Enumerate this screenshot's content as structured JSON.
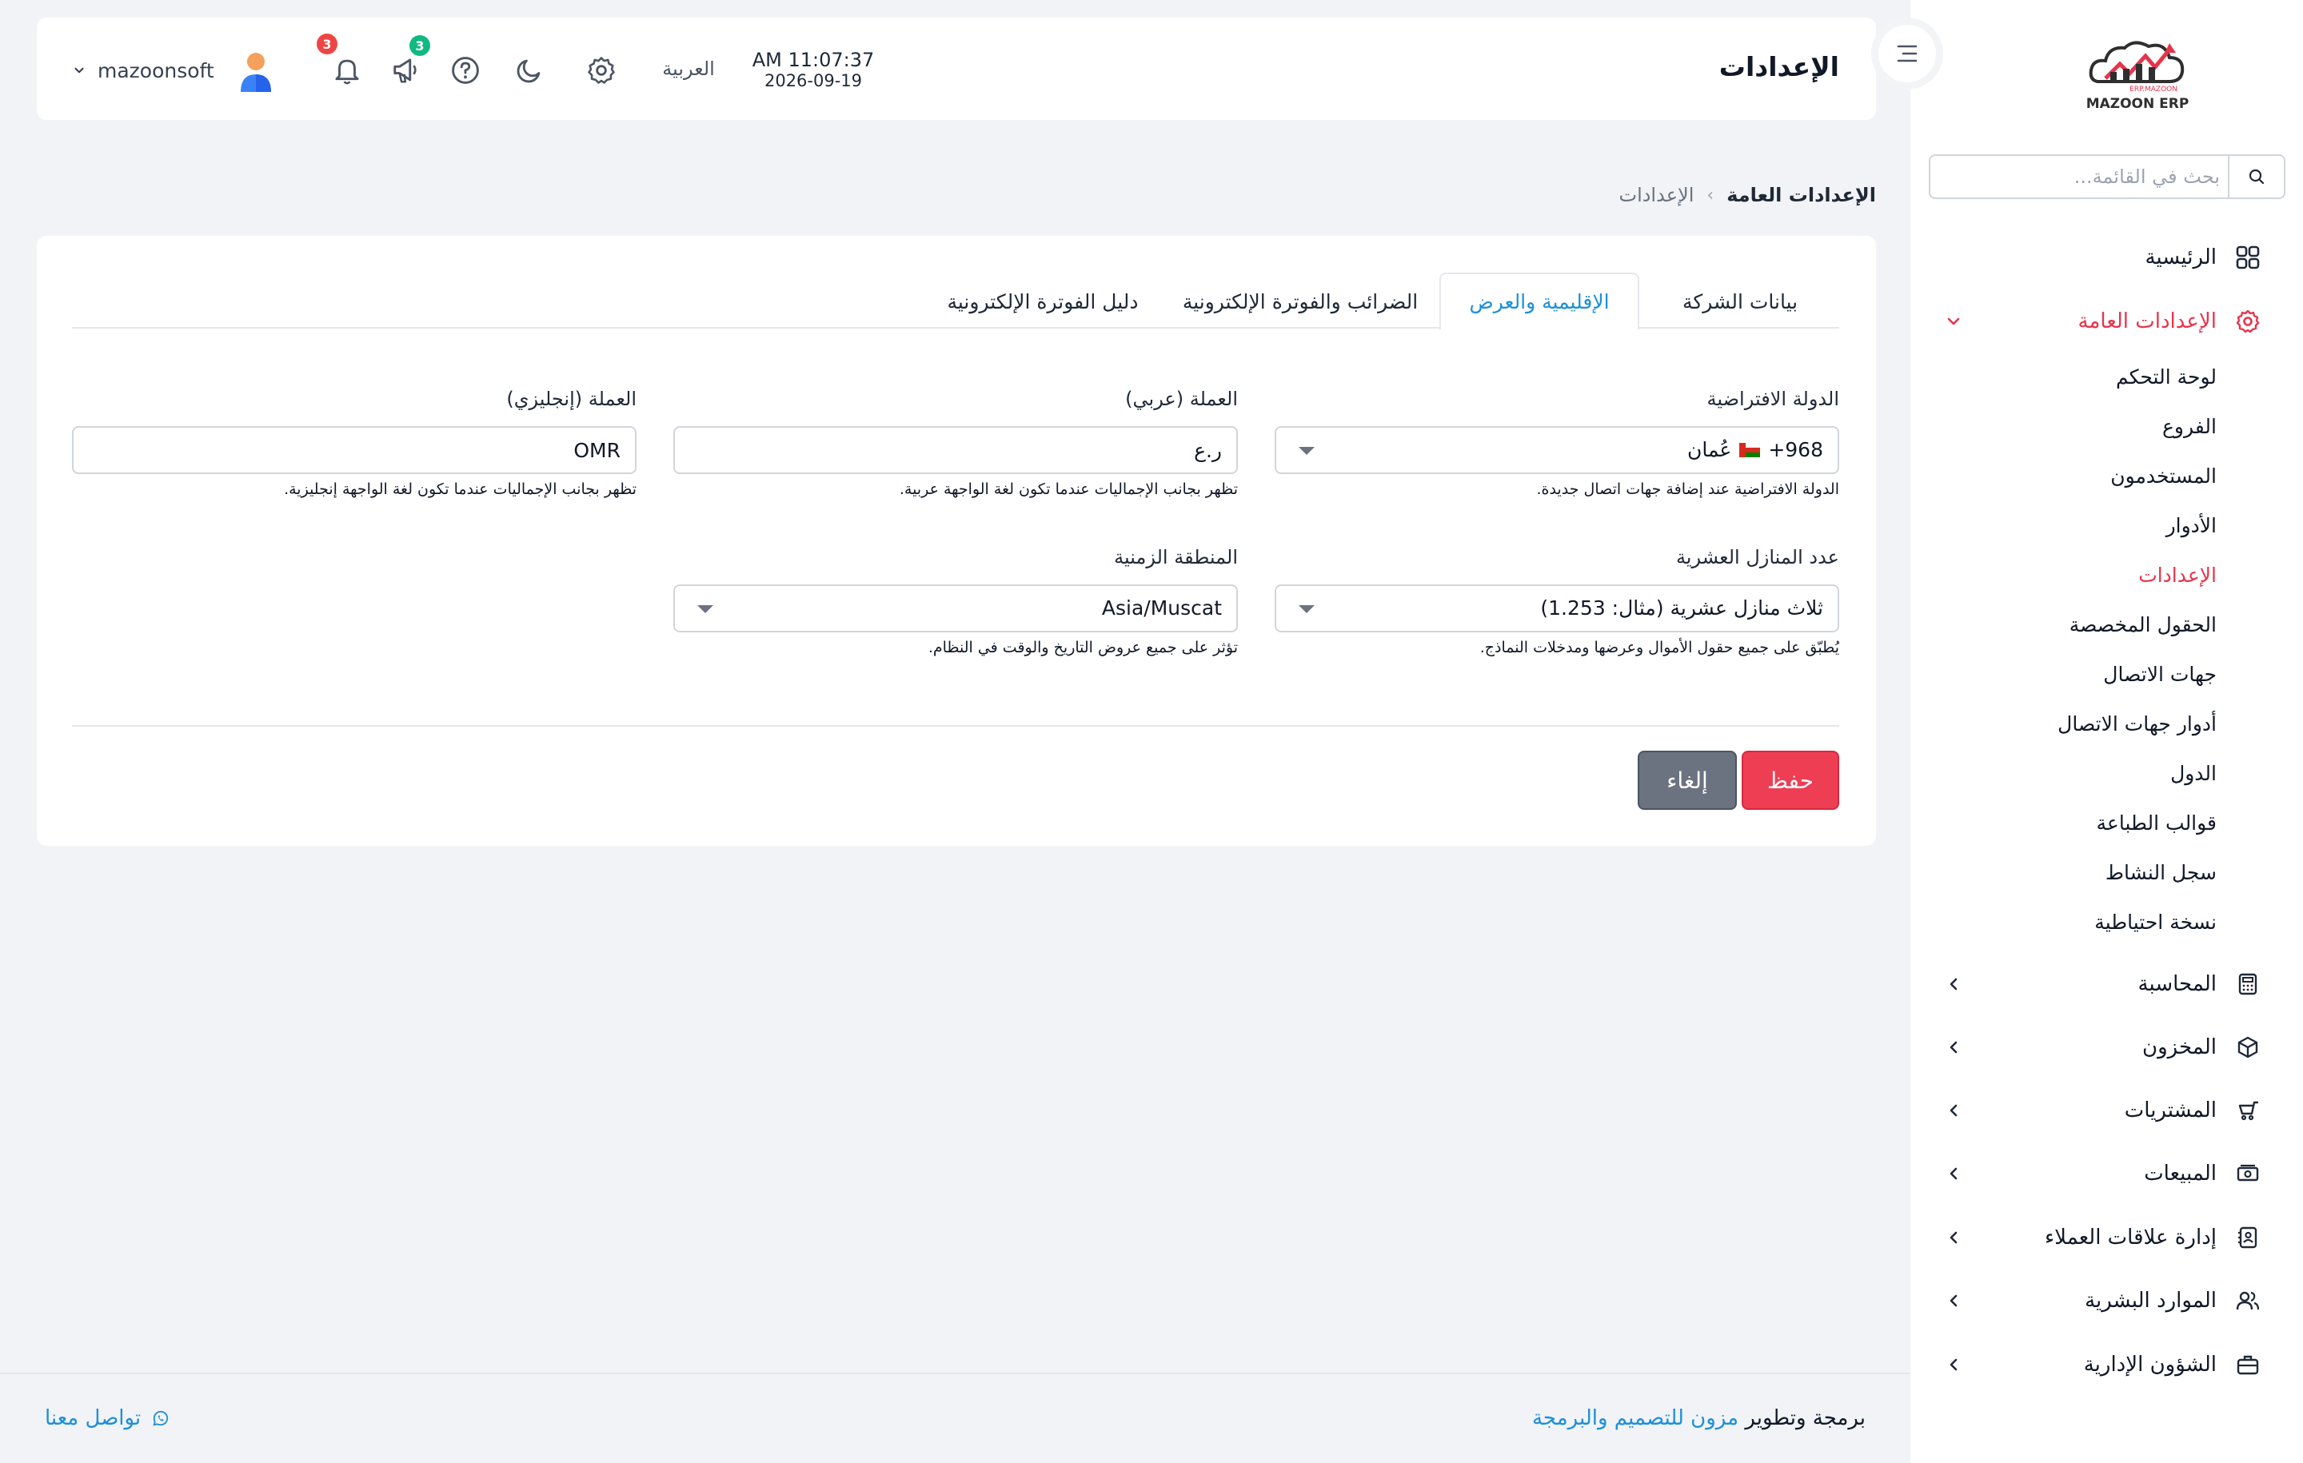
{
  "header": {
    "page_title": "الإعدادات",
    "clock_time": "AM 11:07:37",
    "clock_date": "2026-09-19",
    "language": "العربية",
    "announcement_count": "3",
    "notification_count": "3",
    "username": "mazoonsoft"
  },
  "sidebar": {
    "logo_text": "MAZOON ERP",
    "logo_small": "ERP.MAZOON",
    "search_placeholder": "بحث في القائمة...",
    "items": [
      {
        "label": "الرئيسية",
        "icon": "grid-icon"
      },
      {
        "label": "الإعدادات العامة",
        "icon": "gear-icon",
        "expanded": true
      },
      {
        "label": "المحاسبة",
        "icon": "calculator-icon"
      },
      {
        "label": "المخزون",
        "icon": "box-icon"
      },
      {
        "label": "المشتريات",
        "icon": "cart-icon"
      },
      {
        "label": "المبيعات",
        "icon": "cash-icon"
      },
      {
        "label": "إدارة علاقات العملاء",
        "icon": "contacts-book-icon"
      },
      {
        "label": "الموارد البشرية",
        "icon": "users-icon"
      },
      {
        "label": "الشؤون الإدارية",
        "icon": "briefcase-icon"
      }
    ],
    "sub_items": [
      "لوحة التحكم",
      "الفروع",
      "المستخدمون",
      "الأدوار",
      "الإعدادات",
      "الحقول المخصصة",
      "جهات الاتصال",
      "أدوار جهات الاتصال",
      "الدول",
      "قوالب الطباعة",
      "سجل النشاط",
      "نسخة احتياطية"
    ],
    "active_sub_item": "الإعدادات"
  },
  "breadcrumb": {
    "current": "الإعدادات العامة",
    "separator": "›",
    "parent": "الإعدادات"
  },
  "tabs": [
    {
      "label": "بيانات الشركة",
      "active": false
    },
    {
      "label": "الإقليمية والعرض",
      "active": true
    },
    {
      "label": "الضرائب والفوترة الإلكترونية",
      "active": false
    },
    {
      "label": "دليل الفوترة الإلكترونية",
      "active": false
    }
  ],
  "form": {
    "default_country": {
      "label": "الدولة الافتراضية",
      "value": "عُمان",
      "dial_code": "+968",
      "help": "الدولة الافتراضية عند إضافة جهات اتصال جديدة."
    },
    "currency_ar": {
      "label": "العملة (عربي)",
      "value": "ر.ع",
      "help": "تظهر بجانب الإجماليات عندما تكون لغة الواجهة عربية."
    },
    "currency_en": {
      "label": "العملة (إنجليزي)",
      "value": "OMR",
      "help": "تظهر بجانب الإجماليات عندما تكون لغة الواجهة إنجليزية."
    },
    "decimal_places": {
      "label": "عدد المنازل العشرية",
      "value": "ثلاث منازل عشرية (مثال: 1.253)",
      "help": "يُطبّق على جميع حقول الأموال وعرضها ومدخلات النماذج."
    },
    "timezone": {
      "label": "المنطقة الزمنية",
      "value": "Asia/Muscat",
      "help": "تؤثر على جميع عروض التاريخ والوقت في النظام."
    }
  },
  "actions": {
    "save": "حفظ",
    "cancel": "إلغاء"
  },
  "footer": {
    "credit_prefix": "برمجة وتطوير",
    "credit_company": "مزون للتصميم والبرمجة",
    "contact": "تواصل معنا"
  },
  "colors": {
    "accent_red": "#e5354b",
    "accent_blue": "#1d8fd9",
    "badge_red": "#ef4444",
    "badge_green": "#10b981",
    "save_button": "#ee3e54",
    "cancel_button": "#6b7280"
  }
}
